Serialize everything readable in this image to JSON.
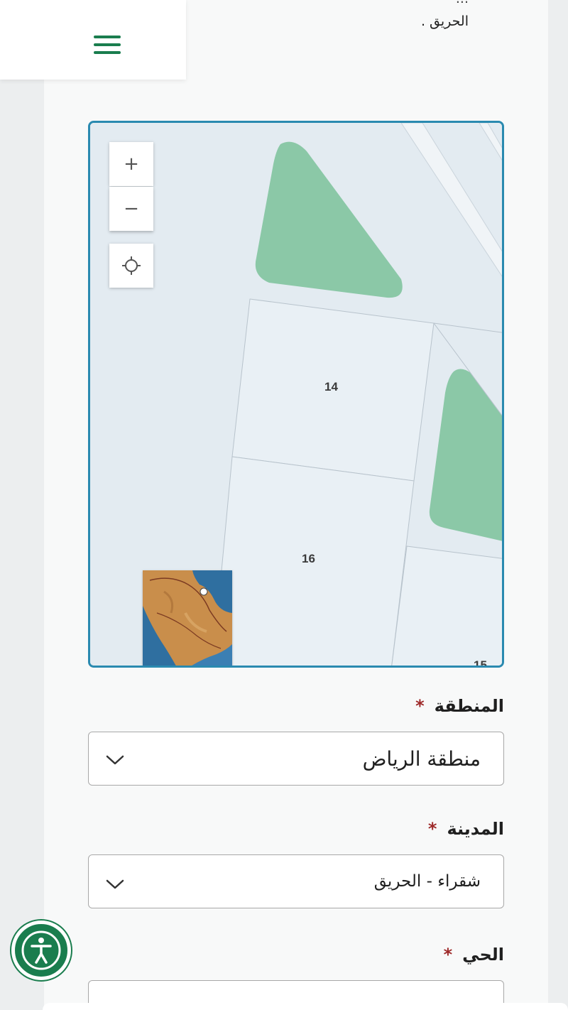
{
  "header": {
    "text_clipped": "...",
    "text_line": "الحريق ."
  },
  "menu": {
    "icon": "hamburger-menu-icon",
    "accent": "#1a7d4e"
  },
  "map": {
    "zoom_in_label": "+",
    "zoom_out_label": "−",
    "locate_icon": "crosshair-icon",
    "parcels": [
      "14",
      "16",
      "15"
    ],
    "park_color": "#8bc8a7",
    "border_color": "#2a8ab0"
  },
  "form": {
    "region": {
      "label": "المنطقة",
      "required": "*",
      "value": "منطقة الرياض"
    },
    "city": {
      "label": "المدينة",
      "required": "*",
      "value": "شقراء - الحريق"
    },
    "district": {
      "label": "الحي",
      "required": "*",
      "value": ""
    }
  },
  "accessibility": {
    "icon": "accessibility-icon"
  }
}
